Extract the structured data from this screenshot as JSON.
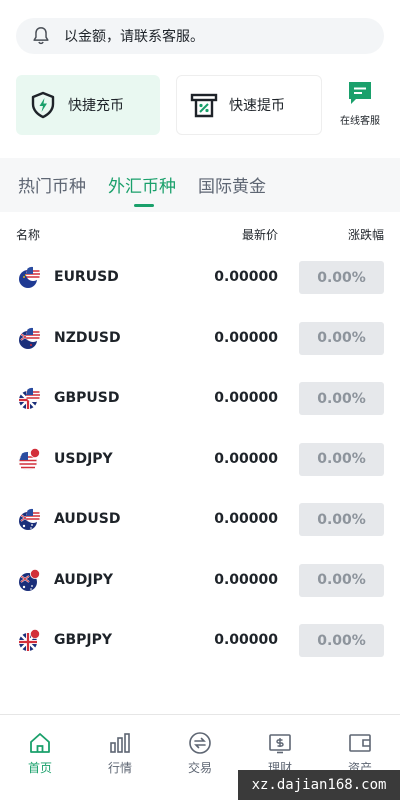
{
  "notice": {
    "text": "以金额，请联系客服。",
    "icon": "bell-icon"
  },
  "quick": {
    "recharge_label": "快捷充币",
    "withdraw_label": "快速提币",
    "service_label": "在线客服"
  },
  "tabs": [
    {
      "label": "热门币种",
      "active": false
    },
    {
      "label": "外汇币种",
      "active": true
    },
    {
      "label": "国际黄金",
      "active": false
    }
  ],
  "table": {
    "headers": {
      "name": "名称",
      "price": "最新价",
      "change": "涨跌幅"
    },
    "rows": [
      {
        "symbol": "EURUSD",
        "price": "0.00000",
        "change": "0.00%"
      },
      {
        "symbol": "NZDUSD",
        "price": "0.00000",
        "change": "0.00%"
      },
      {
        "symbol": "GBPUSD",
        "price": "0.00000",
        "change": "0.00%"
      },
      {
        "symbol": "USDJPY",
        "price": "0.00000",
        "change": "0.00%"
      },
      {
        "symbol": "AUDUSD",
        "price": "0.00000",
        "change": "0.00%"
      },
      {
        "symbol": "AUDJPY",
        "price": "0.00000",
        "change": "0.00%"
      },
      {
        "symbol": "GBPJPY",
        "price": "0.00000",
        "change": "0.00%"
      }
    ]
  },
  "nav": [
    {
      "label": "首页",
      "icon": "home-icon",
      "active": true
    },
    {
      "label": "行情",
      "icon": "chart-bars-icon",
      "active": false
    },
    {
      "label": "交易",
      "icon": "exchange-icon",
      "active": false
    },
    {
      "label": "理财",
      "icon": "finance-icon",
      "active": false
    },
    {
      "label": "资产",
      "icon": "wallet-icon",
      "active": false
    }
  ],
  "watermark": "xz.dajian168.com",
  "colors": {
    "accent": "#1aa06b",
    "badge_bg": "#e6e8eb",
    "badge_text": "#8d949c",
    "recharge_bg": "#e9f8f1"
  }
}
